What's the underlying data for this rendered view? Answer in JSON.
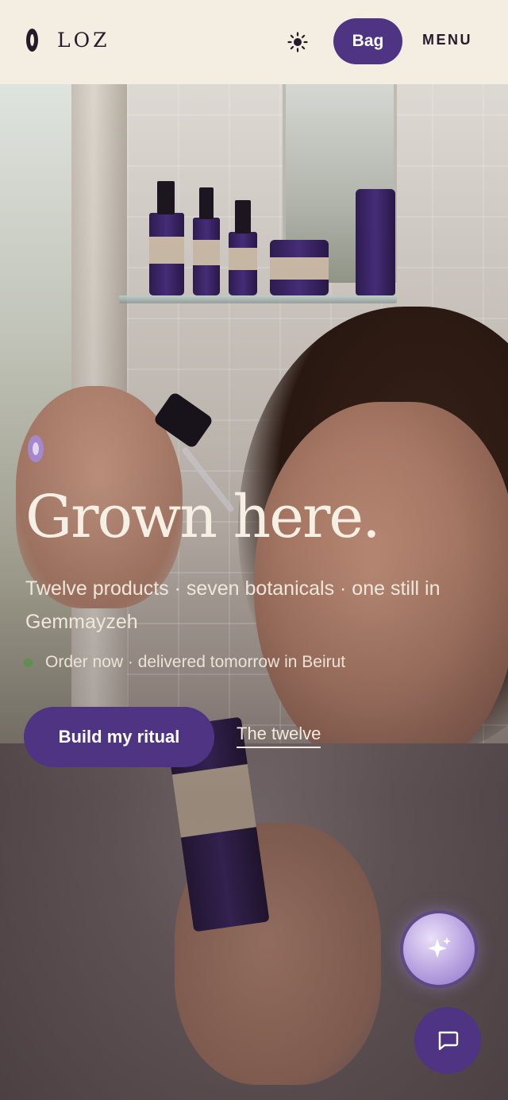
{
  "header": {
    "logo_text": "LOZ",
    "theme_icon": "sun-icon",
    "bag_label": "Bag",
    "menu_label": "MENU"
  },
  "hero": {
    "headline": "Grown here.",
    "subtitle": "Twelve products · seven botanicals · one still in Gemmayzeh",
    "status_text": "Order now · delivered tomorrow in Beirut",
    "primary_cta": "Build my ritual",
    "secondary_cta": "The twelve"
  },
  "floating": {
    "assistant_icon": "sparkle-icon",
    "chat_icon": "chat-bubble-icon"
  },
  "colors": {
    "brand": "#4e3483",
    "header_bg": "#f4ede2",
    "status_dot": "#5f8f4c",
    "text_light": "#f6efe4"
  }
}
